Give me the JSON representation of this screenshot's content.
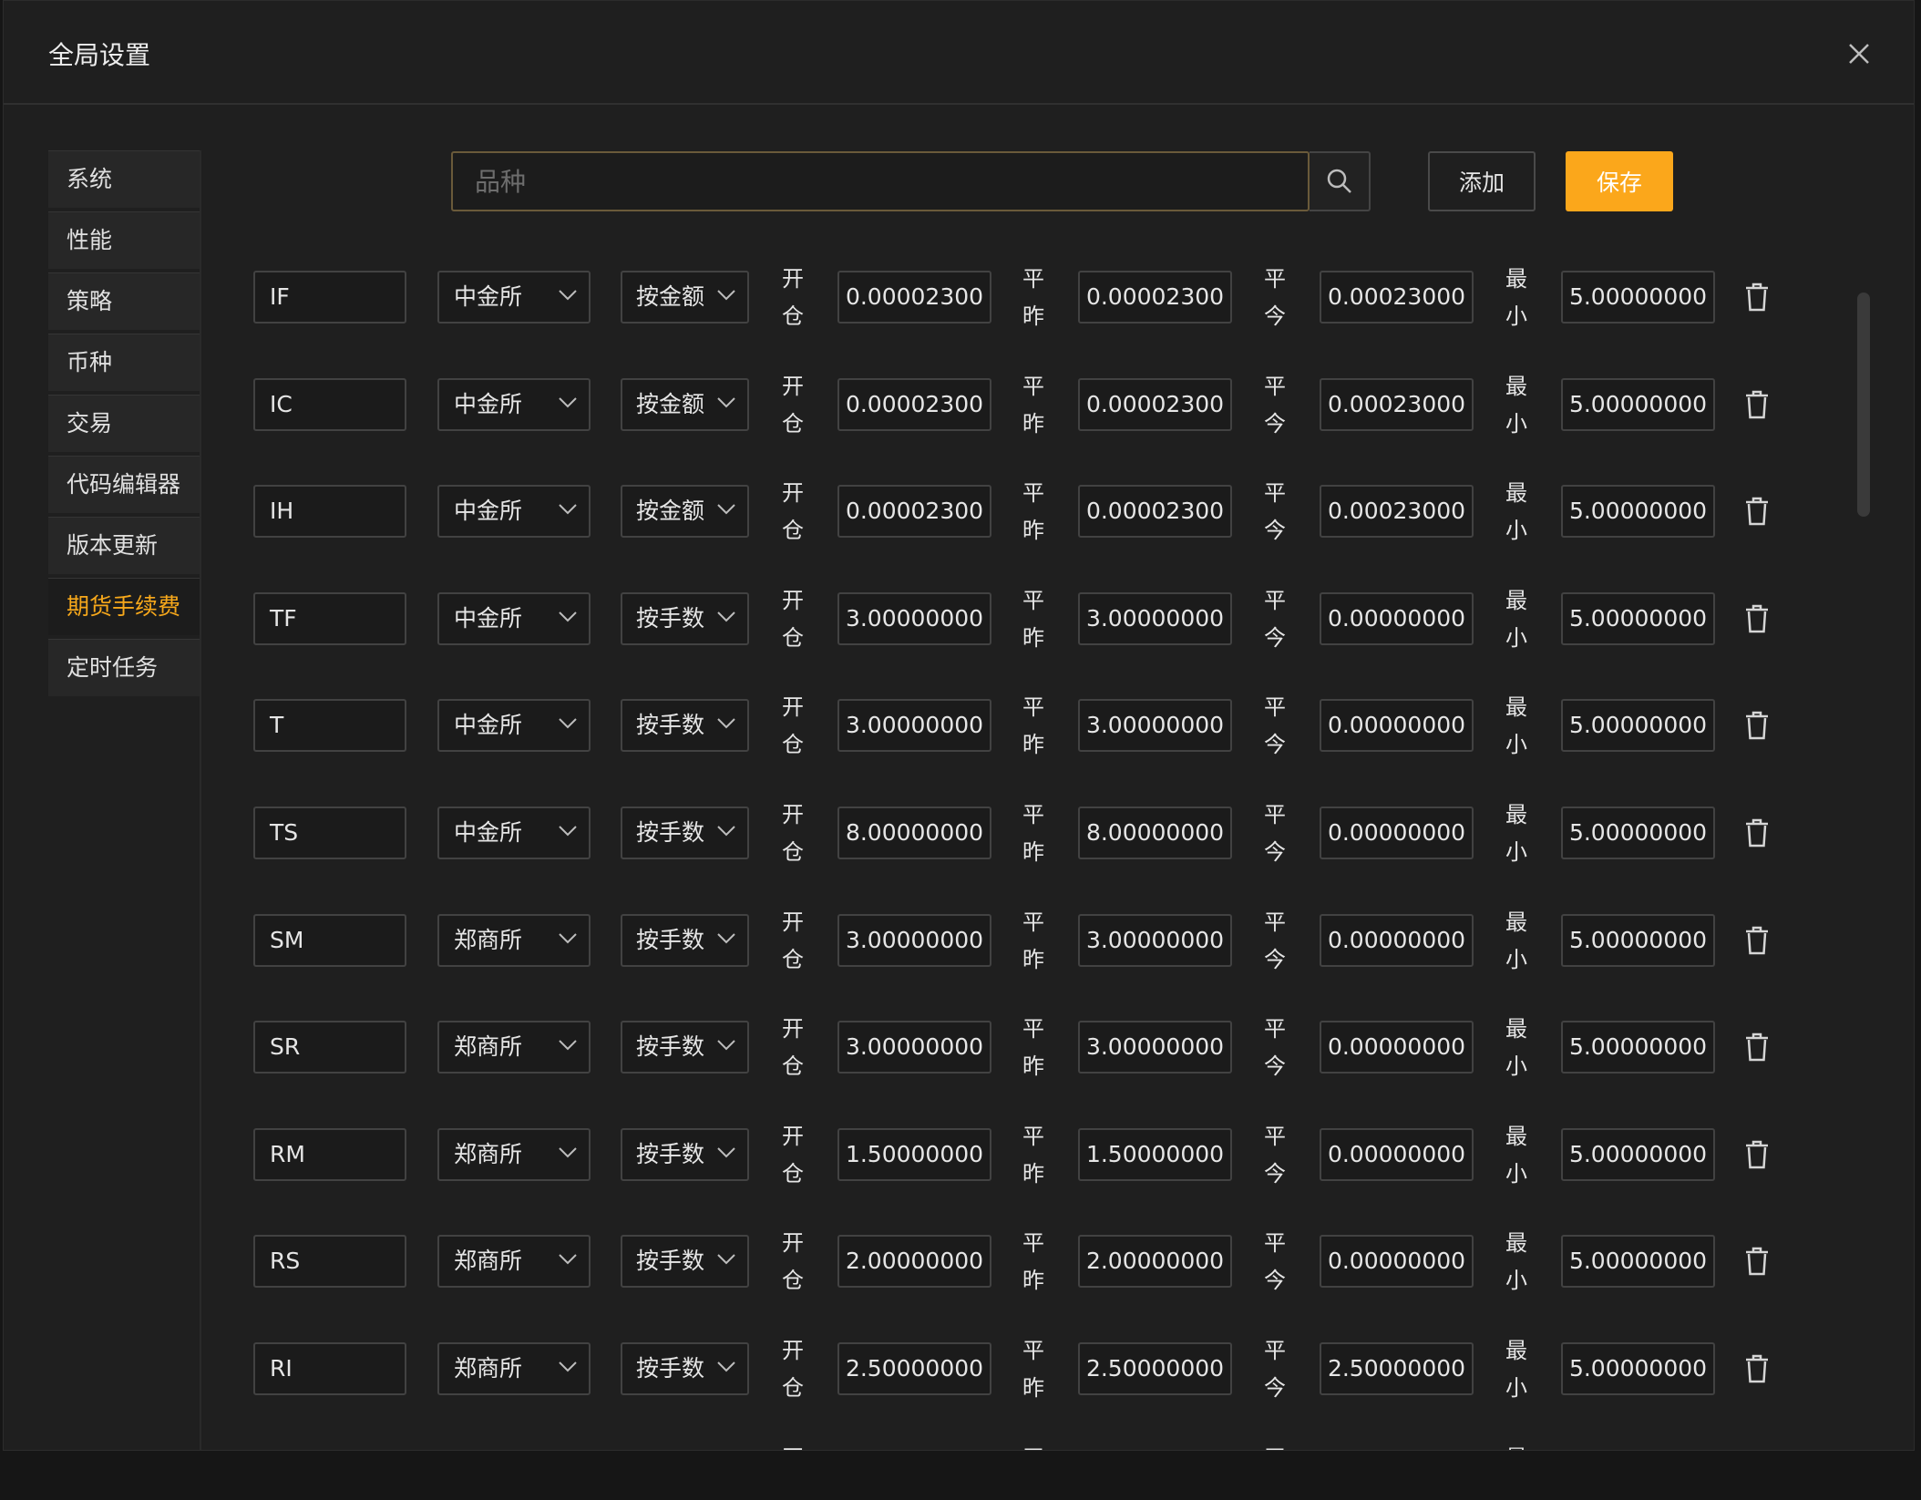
{
  "dialog": {
    "title": "全局设置",
    "close_icon": "close-icon"
  },
  "sidebar": {
    "items": [
      {
        "label": "系统"
      },
      {
        "label": "性能"
      },
      {
        "label": "策略"
      },
      {
        "label": "币种"
      },
      {
        "label": "交易"
      },
      {
        "label": "代码编辑器"
      },
      {
        "label": "版本更新"
      },
      {
        "label": "期货手续费",
        "active": true
      },
      {
        "label": "定时任务"
      }
    ]
  },
  "toolbar": {
    "search_placeholder": "品种",
    "add_label": "添加",
    "save_label": "保存"
  },
  "labels": {
    "open_1": "开",
    "open_2": "仓",
    "yest_1": "平",
    "yest_2": "昨",
    "today_1": "平",
    "today_2": "今",
    "min_1": "最",
    "min_2": "小"
  },
  "colors": {
    "accent": "#fba71b",
    "background": "#1f1f1f"
  },
  "rows": [
    {
      "code": "IF",
      "exchange": "中金所",
      "fee_type": "按金额",
      "open": "0.00002300",
      "close_yesterday": "0.00002300",
      "close_today": "0.00023000",
      "min": "5.00000000"
    },
    {
      "code": "IC",
      "exchange": "中金所",
      "fee_type": "按金额",
      "open": "0.00002300",
      "close_yesterday": "0.00002300",
      "close_today": "0.00023000",
      "min": "5.00000000"
    },
    {
      "code": "IH",
      "exchange": "中金所",
      "fee_type": "按金额",
      "open": "0.00002300",
      "close_yesterday": "0.00002300",
      "close_today": "0.00023000",
      "min": "5.00000000"
    },
    {
      "code": "TF",
      "exchange": "中金所",
      "fee_type": "按手数",
      "open": "3.00000000",
      "close_yesterday": "3.00000000",
      "close_today": "0.00000000",
      "min": "5.00000000"
    },
    {
      "code": "T",
      "exchange": "中金所",
      "fee_type": "按手数",
      "open": "3.00000000",
      "close_yesterday": "3.00000000",
      "close_today": "0.00000000",
      "min": "5.00000000"
    },
    {
      "code": "TS",
      "exchange": "中金所",
      "fee_type": "按手数",
      "open": "8.00000000",
      "close_yesterday": "8.00000000",
      "close_today": "0.00000000",
      "min": "5.00000000"
    },
    {
      "code": "SM",
      "exchange": "郑商所",
      "fee_type": "按手数",
      "open": "3.00000000",
      "close_yesterday": "3.00000000",
      "close_today": "0.00000000",
      "min": "5.00000000"
    },
    {
      "code": "SR",
      "exchange": "郑商所",
      "fee_type": "按手数",
      "open": "3.00000000",
      "close_yesterday": "3.00000000",
      "close_today": "0.00000000",
      "min": "5.00000000"
    },
    {
      "code": "RM",
      "exchange": "郑商所",
      "fee_type": "按手数",
      "open": "1.50000000",
      "close_yesterday": "1.50000000",
      "close_today": "0.00000000",
      "min": "5.00000000"
    },
    {
      "code": "RS",
      "exchange": "郑商所",
      "fee_type": "按手数",
      "open": "2.00000000",
      "close_yesterday": "2.00000000",
      "close_today": "0.00000000",
      "min": "5.00000000"
    },
    {
      "code": "RI",
      "exchange": "郑商所",
      "fee_type": "按手数",
      "open": "2.50000000",
      "close_yesterday": "2.50000000",
      "close_today": "2.50000000",
      "min": "5.00000000"
    },
    {
      "code": "",
      "exchange": "",
      "fee_type": "",
      "open": "",
      "close_yesterday": "",
      "close_today": "",
      "min": ""
    }
  ]
}
